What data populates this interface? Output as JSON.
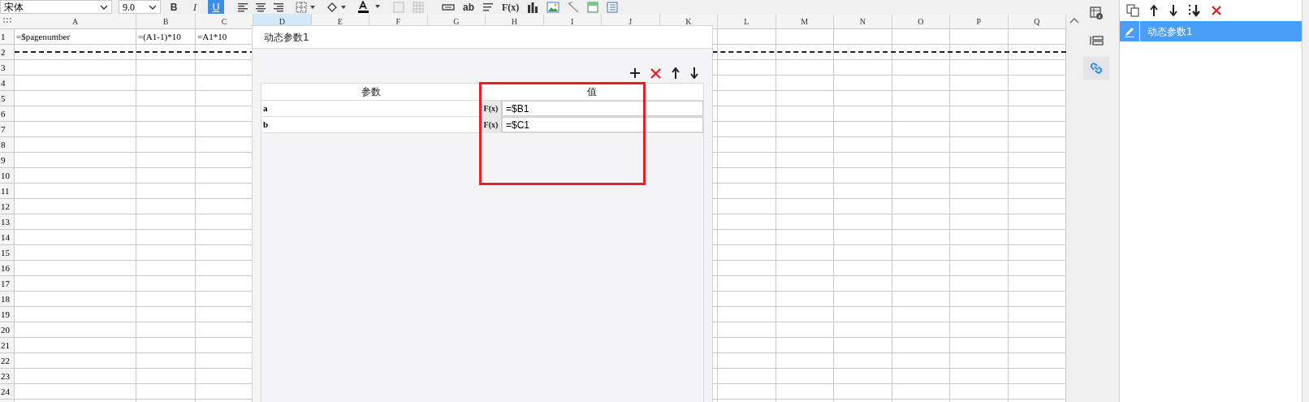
{
  "toolbar": {
    "font": "宋体",
    "font_size": "9.0",
    "format_buttons": [
      {
        "label": "B",
        "selected": false
      },
      {
        "label": "I",
        "selected": false
      },
      {
        "label": "U",
        "selected": true
      }
    ],
    "text_tools": [
      "ab",
      "F(x)"
    ]
  },
  "sheet": {
    "columns": [
      {
        "label": "A",
        "selected": false
      },
      {
        "label": "B",
        "selected": false
      },
      {
        "label": "C",
        "selected": false
      },
      {
        "label": "D",
        "selected": true
      },
      {
        "label": "E",
        "selected": false
      },
      {
        "label": "F",
        "selected": false
      },
      {
        "label": "G",
        "selected": false
      },
      {
        "label": "H",
        "selected": false
      },
      {
        "label": "I",
        "selected": false
      },
      {
        "label": "J",
        "selected": false
      },
      {
        "label": "K",
        "selected": false
      },
      {
        "label": "L",
        "selected": false
      },
      {
        "label": "M",
        "selected": false
      },
      {
        "label": "N",
        "selected": false
      },
      {
        "label": "O",
        "selected": false
      },
      {
        "label": "P",
        "selected": false
      },
      {
        "label": "Q",
        "selected": false
      }
    ],
    "row_numbers": [
      "1",
      "2",
      "3",
      "4",
      "5",
      "6",
      "7",
      "8",
      "9",
      "10",
      "11",
      "12",
      "13",
      "14",
      "15",
      "16",
      "17",
      "18",
      "19",
      "20",
      "21",
      "22",
      "23",
      "24"
    ],
    "cells": [
      [
        "=$pagenumber",
        "=(A1-1)*10",
        "=A1*10"
      ]
    ]
  },
  "dialog": {
    "title": "动态参数1",
    "columns": [
      "参数",
      "值"
    ],
    "rows": [
      {
        "name": "a",
        "formula_button": "F(x)",
        "value": "=$B1"
      },
      {
        "name": "b",
        "formula_button": "F(x)",
        "value": "=$C1"
      }
    ]
  },
  "side_tabs": [
    {
      "selected": false
    },
    {
      "selected": false
    },
    {
      "selected": true
    }
  ],
  "side_panel": {
    "items": [
      {
        "label": "动态参数1",
        "selected": true
      }
    ]
  }
}
